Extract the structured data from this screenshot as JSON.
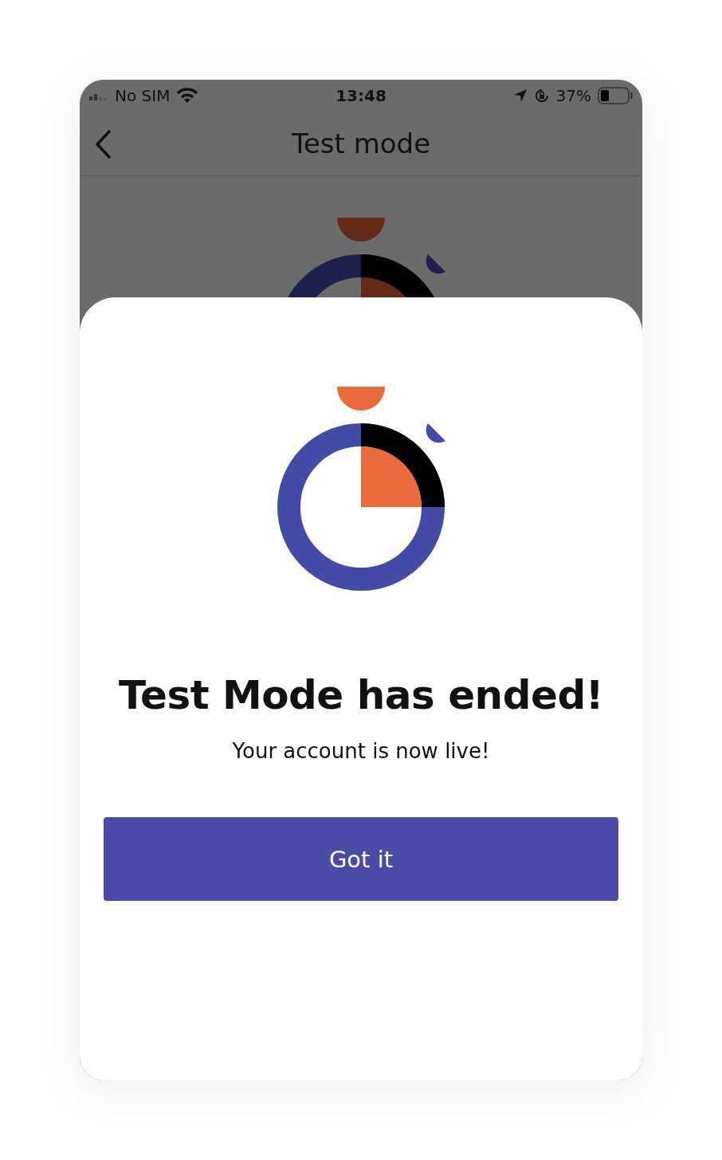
{
  "status_bar": {
    "carrier": "No SIM",
    "time": "13:48",
    "battery": "37%"
  },
  "nav": {
    "title": "Test mode"
  },
  "sheet": {
    "title": "Test Mode has ended!",
    "message": "Your account is now live!",
    "button": "Got it"
  }
}
